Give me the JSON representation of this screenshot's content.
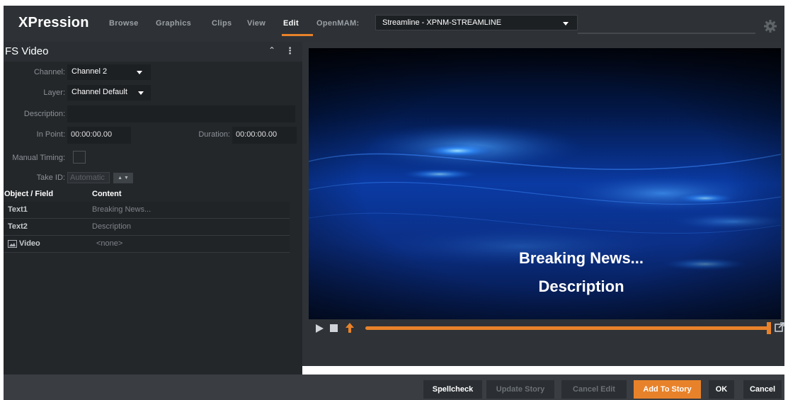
{
  "app": {
    "logo": "XPression"
  },
  "nav": {
    "items": [
      "Browse",
      "Graphics",
      "Clips",
      "View",
      "Edit",
      "OpenMAM:"
    ],
    "active": "Edit",
    "accent_color": "#e8822a"
  },
  "openmam_select": {
    "value": "Streamline - XPNM-STREAMLINE"
  },
  "panel": {
    "title": "FS Video",
    "channel": {
      "label": "Channel:",
      "value": "Channel 2"
    },
    "layer": {
      "label": "Layer:",
      "value": "Channel Default"
    },
    "description": {
      "label": "Description:",
      "value": ""
    },
    "in_point": {
      "label": "In Point:",
      "value": "00:00:00.00"
    },
    "duration": {
      "label": "Duration:",
      "value": "00:00:00.00"
    },
    "manual_timing": {
      "label": "Manual Timing:",
      "checked": false
    },
    "take_id": {
      "label": "Take ID:",
      "value": "Automatic"
    }
  },
  "table": {
    "headers": [
      "Object / Field",
      "Content"
    ],
    "rows": [
      {
        "field": "Text1",
        "content": "Breaking News..."
      },
      {
        "field": "Text2",
        "content": "Description"
      },
      {
        "field": "Video",
        "content": "<none>",
        "icon": "image-icon"
      }
    ]
  },
  "preview": {
    "title": "Breaking News...",
    "description": "Description"
  },
  "buttons": {
    "spellcheck": "Spellcheck",
    "update_story": "Update Story",
    "cancel_edit": "Cancel Edit",
    "add_to_story": "Add To Story",
    "ok": "OK",
    "cancel": "Cancel"
  }
}
